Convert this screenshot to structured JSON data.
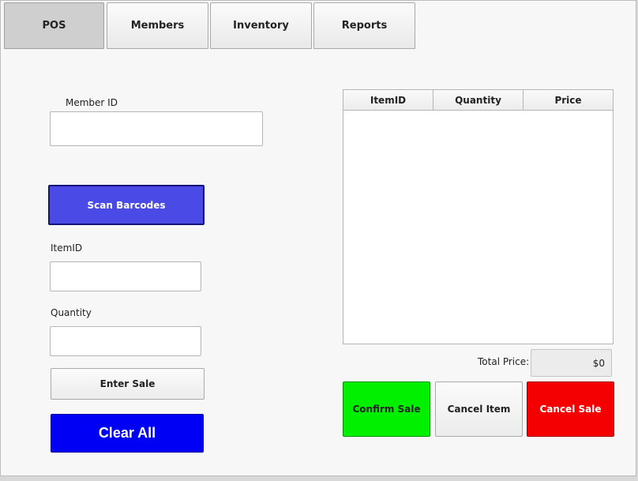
{
  "tabs": [
    {
      "label": "POS"
    },
    {
      "label": "Members"
    },
    {
      "label": "Inventory"
    },
    {
      "label": "Reports"
    }
  ],
  "form": {
    "member_id_label": "Member ID",
    "member_id_value": "",
    "scan_button": "Scan Barcodes",
    "item_id_label": "ItemID",
    "item_id_value": "",
    "quantity_label": "Quantity",
    "quantity_value": "",
    "enter_sale_button": "Enter Sale",
    "clear_all_button": "Clear All"
  },
  "sale_table": {
    "columns": [
      "ItemID",
      "Quantity",
      "Price"
    ],
    "rows": []
  },
  "totals": {
    "label": "Total Price:",
    "value": "$0"
  },
  "actions": {
    "confirm": "Confirm Sale",
    "cancel_item": "Cancel Item",
    "cancel_sale": "Cancel Sale"
  },
  "colors": {
    "scan_button": "#4a4ae6",
    "clear_all_button": "#0000f5",
    "confirm_button": "#00f000",
    "cancel_sale_button": "#f50000"
  }
}
